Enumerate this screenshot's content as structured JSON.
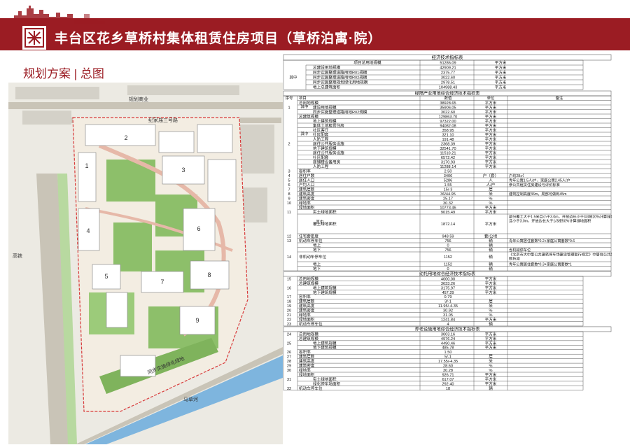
{
  "header": {
    "title": "丰台区花乡草桥村集体租赁住房项目（草桥泊寓·院）",
    "section": "规划方案 | 总图"
  },
  "colors": {
    "brand": "#9b1c23",
    "green": "#8dbf6a",
    "road": "#c9c4b7"
  },
  "site_plan": {
    "road_labels": [
      "规划商业",
      "纪家庙三号路",
      "高铁",
      "马草河",
      "同步实施绿化绿地"
    ],
    "building_numbers": [
      "1",
      "2",
      "3",
      "4",
      "5",
      "6",
      "7",
      "8",
      "9"
    ]
  },
  "tables": {
    "t1": {
      "title": "经济技术指标表",
      "rows": [
        [
          "项目总用地规模",
          "51286.09",
          "平方米"
        ],
        [
          "总建设用地规模",
          "42909.21",
          "平方米"
        ],
        [
          "同步实施整理道路用地R01规模",
          "2375.77",
          "平方米"
        ],
        [
          "同步实施整理道路用地R02规模",
          "3022.60",
          "平方米"
        ],
        [
          "同步实施整理规划绿化用地规模",
          "2978.51",
          "平方米"
        ],
        [
          "地上总建筑面积",
          "104988.43",
          "平方米"
        ]
      ],
      "group": "其中"
    },
    "t2": {
      "title": "绿隔产业用地综合经济技术指标表",
      "headers": [
        "序号",
        "项目",
        "数值",
        "单位",
        "备注"
      ],
      "rows": [
        [
          "",
          "总用地规模",
          "38928.65",
          "平方米",
          ""
        ],
        [
          "1",
          "建设用地规模",
          "35906.05",
          "平方米",
          ""
        ],
        [
          "",
          "同步实施整理道路用地R02规模",
          "3022.60",
          "平方米",
          ""
        ],
        [
          "",
          "总建筑规模",
          "129863.70",
          "平方米",
          ""
        ],
        [
          "",
          "地上建筑规模",
          "97322.00",
          "平方米",
          ""
        ],
        [
          "",
          "集体土地租赁住房",
          "94082.08",
          "平方米",
          ""
        ],
        [
          "",
          "社区客厅",
          "358.95",
          "平方米",
          ""
        ],
        [
          "",
          "社区配套",
          "321.10",
          "平方米",
          ""
        ],
        [
          "",
          "人防工程",
          "191.48",
          "平方米",
          ""
        ],
        [
          "2",
          "居住公共服务设施",
          "2368.39",
          "平方米",
          ""
        ],
        [
          "",
          "地下建筑规模",
          "32541.70",
          "平方米",
          ""
        ],
        [
          "",
          "居住公共服务设施",
          "11510.21",
          "平方米",
          ""
        ],
        [
          "",
          "社区配套",
          "6572.42",
          "平方米",
          ""
        ],
        [
          "",
          "商铺楼设备用房",
          "3170.93",
          "平方米",
          ""
        ],
        [
          "",
          "人防工程",
          "11288.14",
          "平方米",
          ""
        ],
        [
          "3",
          "容积率",
          "2.50",
          "",
          ""
        ],
        [
          "4",
          "居住户数",
          "3406",
          "户（套）",
          "户均28㎡"
        ],
        [
          "5",
          "居住人口",
          "5286",
          "人",
          "青年公寓1.5人/户，家庭公寓2.45人/户"
        ],
        [
          "6",
          "户均人口",
          "1.55",
          "人/户",
          "参公共租赁住房建设与评价标准"
        ],
        [
          "7",
          "建筑层数",
          "15/-3",
          "层",
          ""
        ],
        [
          "8",
          "建筑高度",
          "36/44.95",
          "米",
          "建筑控制高度36m，局部可做到45m"
        ],
        [
          "9",
          "建筑密度",
          "25.17",
          "%",
          ""
        ],
        [
          "10",
          "绿地率",
          "30.32",
          "%",
          ""
        ],
        [
          "",
          "绿地面积",
          "10773.46",
          "平方米",
          ""
        ],
        [
          "11",
          "实土绿地面积",
          "9015.49",
          "平方米",
          ""
        ],
        [
          "",
          "覆土绿地面积",
          "1872.14",
          "平方米",
          "部分覆土大于1.5米且小于3.0m，开放边长小于3/3按20%计算绿地面积；部分覆土大于1.5米且小于3.0m，开放边长大于1/3按50%计算绿地面积"
        ],
        [
          "12",
          "住宅套密度",
          "948.59",
          "套/公顷",
          ""
        ],
        [
          "13",
          "机动车停车位",
          "756",
          "辆",
          "青年公寓居住套数*0.2+家庭公寓套数*0.6"
        ],
        [
          "",
          "地上",
          "0",
          "辆",
          ""
        ],
        [
          "",
          "地下",
          "756",
          "辆",
          "含机械停车位"
        ],
        [
          "14",
          "非机动车停车位",
          "1152",
          "辆",
          "《北京市大中型公共建筑停车场建设管理暂行规定》中居住公共服务设施200辆/万平米，同时根据户均人数折减"
        ],
        [
          "",
          "地上",
          "1152",
          "辆",
          "青年公寓居住套数*0.3+家庭公寓套数*1"
        ],
        [
          "",
          "地下",
          "0",
          "辆",
          ""
        ]
      ]
    },
    "t3": {
      "title": "幼托用地综合经济技术指标表",
      "rows": [
        [
          "15",
          "总用地规模",
          "4000.00",
          "平方米"
        ],
        [
          "",
          "总建筑规模",
          "3633.26",
          "平方米"
        ],
        [
          "16",
          "地上建筑规模",
          "3175.97",
          "平方米"
        ],
        [
          "",
          "地下建筑规模",
          "457.29",
          "平方米"
        ],
        [
          "17",
          "容积率",
          "0.79",
          ""
        ],
        [
          "18",
          "建筑层数",
          "3/-1",
          "层"
        ],
        [
          "19",
          "建筑高度",
          "11.95/-4.35",
          "米"
        ],
        [
          "20",
          "建筑密度",
          "30.92",
          "%"
        ],
        [
          "21",
          "绿地率",
          "31.05",
          "%"
        ],
        [
          "22",
          "绿地面积",
          "1241.84",
          "平方米"
        ],
        [
          "23",
          "机动车停车位",
          "4",
          "辆"
        ]
      ]
    },
    "t4": {
      "title": "养老设施用地综合经济技术指标表",
      "rows": [
        [
          "24",
          "总用地规模",
          "3003.16",
          "平方米"
        ],
        [
          "",
          "总建筑规模",
          "4976.24",
          "平方米"
        ],
        [
          "25",
          "地上建筑规模",
          "4490.46",
          "平方米"
        ],
        [
          "",
          "地下建筑规模",
          "485.78",
          "平方米"
        ],
        [
          "26",
          "容积率",
          "1.50",
          ""
        ],
        [
          "27",
          "建筑层数",
          "5/-1",
          "层"
        ],
        [
          "28",
          "建筑高度",
          "17.55/-4.35",
          "米"
        ],
        [
          "29",
          "建筑密度",
          "28.60",
          "%"
        ],
        [
          "30",
          "绿地率",
          "30.28",
          "%"
        ],
        [
          "",
          "绿地面积",
          "926.71",
          "平方米"
        ],
        [
          "31",
          "实土绿地面积",
          "617.07",
          "平方米"
        ],
        [
          "",
          "绿化停车场面积",
          "292.40",
          "平方米"
        ],
        [
          "32",
          "机动车停车位",
          "18",
          "辆"
        ]
      ]
    }
  }
}
